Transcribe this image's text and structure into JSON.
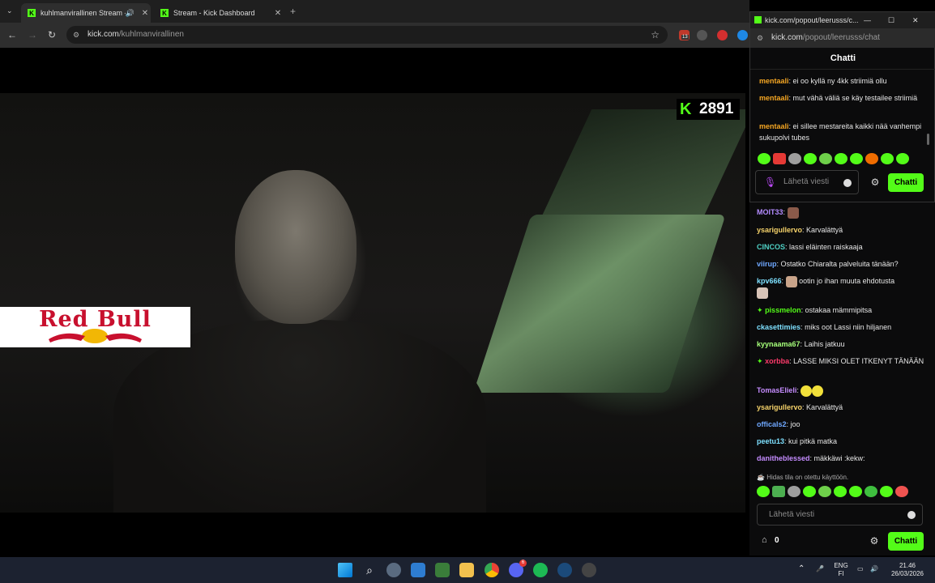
{
  "browser": {
    "tabs": [
      {
        "title": "kuhlmanvirallinen Stream -"
      },
      {
        "title": "Stream - Kick Dashboard"
      }
    ],
    "url_domain": "kick.com",
    "url_path": "/kuhlmanvirallinen",
    "extension_badge": "13"
  },
  "stream": {
    "viewer_count": "2891",
    "overlay_text": "Red Bull"
  },
  "popout": {
    "window_title": "kick.com/popout/leerusss/c...",
    "url_domain": "kick.com",
    "url_path": "/popout/leerusss/chat",
    "header": "Chatti",
    "messages": [
      {
        "user": "mentaali",
        "color": "#f5a623",
        "text": "ei oo kyllä ny 4kk striimiä ollu"
      },
      {
        "user": "mentaali",
        "color": "#f5a623",
        "text": "mut vähä väliä se käy testailee striimiä"
      },
      {
        "user": "mentaali",
        "color": "#f5a623",
        "text": "ei sillee mestareita kaikki nää vanhempi sukupolvi tubes"
      }
    ],
    "input_placeholder": "Lähetä viesti",
    "send_label": "Chatti"
  },
  "chat": {
    "messages": [
      {
        "user": "MOIT33",
        "color": "#b48cff",
        "text": ""
      },
      {
        "user": "ysarigullervo",
        "color": "#f5d26a",
        "text": "Karvalättyä"
      },
      {
        "user": "CINCOS",
        "color": "#4fd1c5",
        "text": "lassi eläinten raiskaaja"
      },
      {
        "user": "viirup",
        "color": "#6fa8ff",
        "text": "Ostatko Chiaralta palveluita tänään?"
      },
      {
        "user": "kpv666",
        "color": "#7ee0ff",
        "text": "ootin jo ihan muuta ehdotusta"
      },
      {
        "user": "pissmelon",
        "color": "#53fc18",
        "text": "ostakaa mämmipitsa"
      },
      {
        "user": "ckasettimies",
        "color": "#7ee0ff",
        "text": "miks oot Lassi niin hiljanen"
      },
      {
        "user": "kyynaama67",
        "color": "#a6ff7a",
        "text": "Laihis jatkuu"
      },
      {
        "user": "xorbba",
        "color": "#ff3b6b",
        "text": "LASSE MIKSI OLET ITKENYT TÄNÄÄN"
      },
      {
        "user": "TomasElieli",
        "color": "#c58cff",
        "text": ""
      },
      {
        "user": "ysarigullervo",
        "color": "#f5d26a",
        "text": "Karvalättyä"
      },
      {
        "user": "officals2",
        "color": "#6fa8ff",
        "text": "joo"
      },
      {
        "user": "peetu13",
        "color": "#7ee0ff",
        "text": "kui pitkä matka"
      },
      {
        "user": "danitheblessed",
        "color": "#c58cff",
        "text": "mäkkäwi :kekw:"
      }
    ],
    "slow_mode": "Hidas tila on otettu käyttöön.",
    "input_placeholder": "Lähetä viesti",
    "send_label": "Chatti",
    "points": "0"
  },
  "taskbar": {
    "lang": "ENG",
    "region": "FI",
    "time": "21.46",
    "date": "26/03/2026",
    "discord_badge": "6"
  }
}
